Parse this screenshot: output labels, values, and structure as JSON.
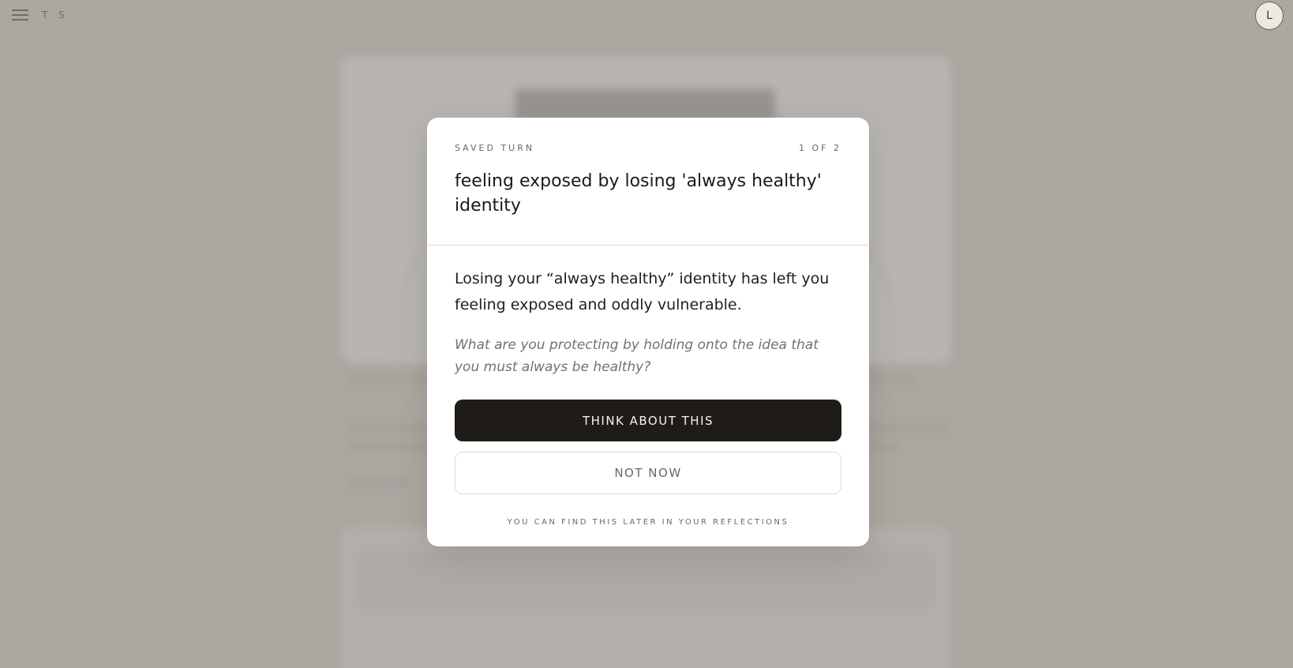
{
  "header": {
    "brand": "T S",
    "avatar_initial": "L",
    "menu_icon": "hamburger-menu-icon"
  },
  "modal": {
    "eyebrow": "SAVED TURN",
    "counter": "1 OF 2",
    "title": "feeling exposed by losing 'always healthy' identity",
    "summary": "Losing your “always healthy” identity has left you feeling exposed and oddly vulnerable.",
    "question": "What are you protecting by holding onto the idea that you must always be healthy?",
    "primary_button": "THINK ABOUT THIS",
    "secondary_button": "NOT NOW",
    "footnote": "YOU CAN FIND THIS LATER IN YOUR REFLECTIONS"
  },
  "colors": {
    "backdrop": "#b1aea8",
    "modal_bg": "#ffffff",
    "primary_button_bg": "#1f1c17",
    "muted_text": "#6b6862"
  }
}
